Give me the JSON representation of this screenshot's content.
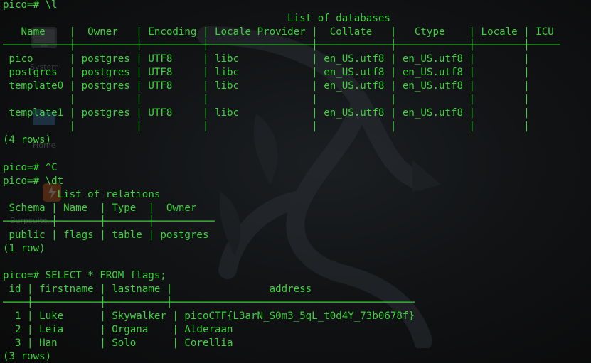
{
  "colors": {
    "terminal_text": "#3bd33a",
    "background": "#0d0d0d"
  },
  "wallpaper": {
    "logo_icon": "kali-dragon-icon"
  },
  "desktop": {
    "faded_items": [
      {
        "icon": "system-icon",
        "label": "System"
      },
      {
        "icon": "home-folder-icon",
        "label": "Home"
      },
      {
        "icon": "burpsuite-icon",
        "label": "Burpsuite..."
      }
    ]
  },
  "terminal": {
    "lines": [
      {
        "prompt": "pico=#",
        "command": " \\l"
      },
      {
        "text": "                                               List of databases"
      },
      {
        "text": "   Name    |  Owner   | Encoding | Locale Provider |  Collate   |   Ctype    | Locale | ICU"
      },
      {
        "text": "-----------+----------+----------+-----------------+------------+------------+--------+-----"
      },
      {
        "text": " pico      | postgres | UTF8     | libc            | en_US.utf8 | en_US.utf8 |        |"
      },
      {
        "text": " postgres  | postgres | UTF8     | libc            | en_US.utf8 | en_US.utf8 |        |"
      },
      {
        "text": " template0 | postgres | UTF8     | libc            | en_US.utf8 | en_US.utf8 |        |"
      },
      {
        "text": "           |          |          |                 |            |            |        |"
      },
      {
        "text": " template1 | postgres | UTF8     | libc            | en_US.utf8 | en_US.utf8 |        |"
      },
      {
        "text": "           |          |          |                 |            |            |        |"
      },
      {
        "text": "(4 rows)"
      },
      {
        "text": ""
      },
      {
        "prompt": "pico=#",
        "command": " ^C"
      },
      {
        "prompt": "pico=#",
        "command": " \\dt"
      },
      {
        "text": "         List of relations"
      },
      {
        "text": " Schema | Name  | Type  |  Owner"
      },
      {
        "text": "--------+-------+-------+----------"
      },
      {
        "text": " public | flags | table | postgres"
      },
      {
        "text": "(1 row)"
      },
      {
        "text": ""
      },
      {
        "prompt": "pico=#",
        "command": " SELECT * FROM flags;"
      },
      {
        "text": " id | firstname | lastname |                address"
      },
      {
        "text": "----+-----------+----------+----------------------------------------"
      },
      {
        "text": "  1 | Luke      | Skywalker | picoCTF{L3arN_S0m3_5qL_t0d4Y_73b0678f}"
      },
      {
        "text": "  2 | Leia      | Organa    | Alderaan"
      },
      {
        "text": "  3 | Han       | Solo      | Corellia"
      },
      {
        "text": "(3 rows)"
      }
    ]
  }
}
